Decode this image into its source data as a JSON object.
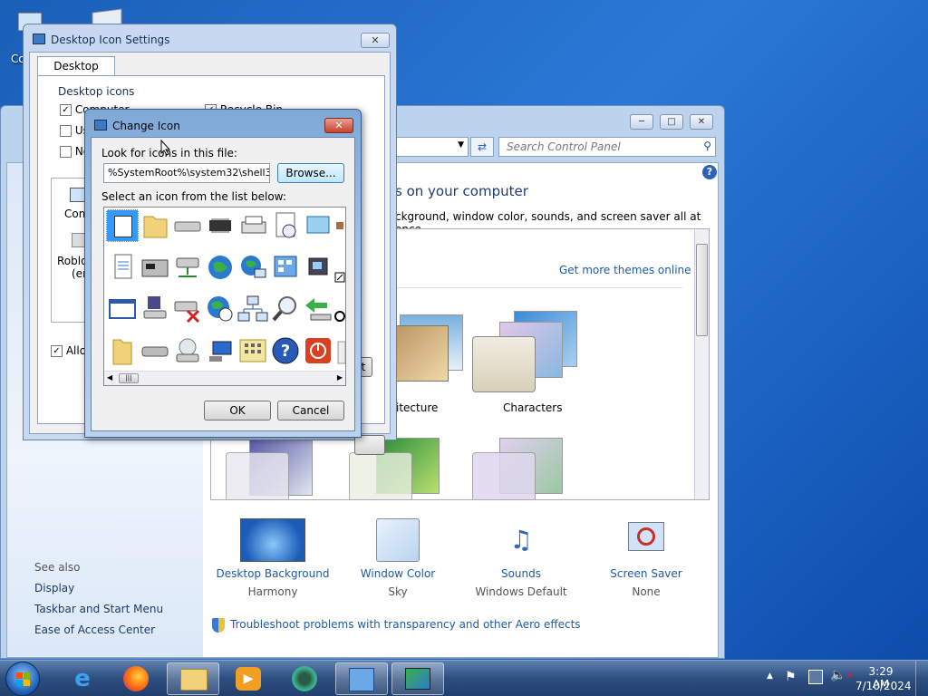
{
  "desktop": {
    "icon_label_partial": "Co"
  },
  "personalization": {
    "search_placeholder": "Search Control Panel",
    "heading_partial": "s on your computer",
    "subheading_partial": "ckground, window color, sounds, and screen saver all at once.",
    "get_more_themes": "Get more themes online",
    "themes": [
      {
        "label": "itecture"
      },
      {
        "label": "Characters"
      }
    ],
    "see_also": {
      "title": "See also",
      "links": [
        "Display",
        "Taskbar and Start Menu",
        "Ease of Access Center"
      ]
    },
    "bottom_tiles": [
      {
        "label": "Desktop Background",
        "value": "Harmony",
        "icon": "desktop-background-icon"
      },
      {
        "label": "Window Color",
        "value": "Sky",
        "icon": "window-color-icon"
      },
      {
        "label": "Sounds",
        "value": "Windows Default",
        "icon": "sounds-icon"
      },
      {
        "label": "Screen Saver",
        "value": "None",
        "icon": "screen-saver-icon"
      }
    ],
    "troubleshoot_link": "Troubleshoot problems with transparency and other Aero effects"
  },
  "desktop_icon_settings": {
    "title": "Desktop Icon Settings",
    "tab": "Desktop Icons",
    "group_label": "Desktop icons",
    "checkboxes": [
      {
        "label": "Computer",
        "checked": true
      },
      {
        "label": "Recycle Bin",
        "checked": true
      },
      {
        "label": "Use",
        "checked": false
      },
      {
        "label": "Ne",
        "checked": false
      }
    ],
    "icon_labels": [
      "Comp",
      "Roblox",
      "(em"
    ],
    "allow_label": "Allow",
    "partial_button": "t"
  },
  "change_icon": {
    "title": "Change Icon",
    "look_for_label": "Look for icons in this file:",
    "file_path": "%SystemRoot%\\system32\\shell32.d",
    "browse_button": "Browse...",
    "select_label": "Select an icon from the list below:",
    "ok_button": "OK",
    "cancel_button": "Cancel"
  },
  "taskbar": {
    "time": "3:29 AM",
    "date": "7/10/2024"
  }
}
